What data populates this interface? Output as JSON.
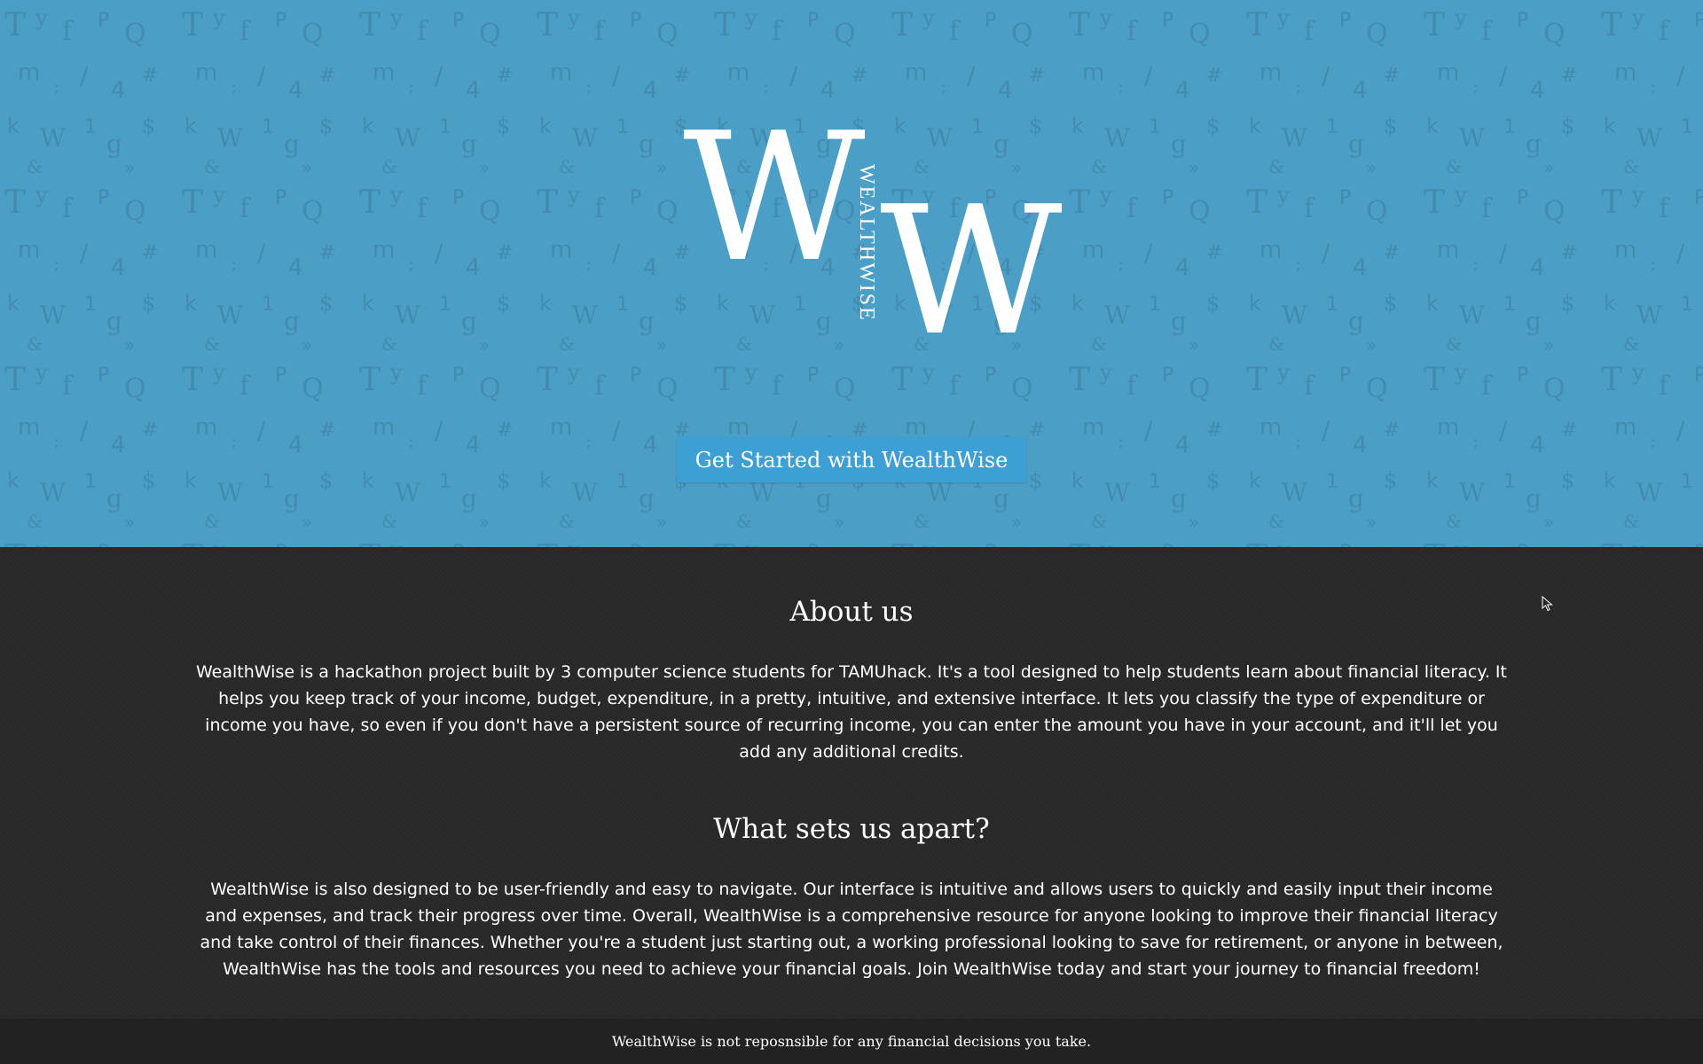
{
  "hero": {
    "logo": {
      "letter_left": "W",
      "letter_right": "W",
      "wordmark": "WEALTHWISE"
    },
    "cta_label": "Get Started with WealthWise",
    "background_color": "#4b9fc7",
    "button_color": "#3d9fd4"
  },
  "about": {
    "title": "About us",
    "text": "WealthWise is a hackathon project built by 3 computer science students for TAMUhack. It's a tool designed to help students learn about financial literacy. It helps you keep track of your income, budget, expenditure, in a pretty, intuitive, and extensive interface. It lets you classify the type of expenditure or income you have, so even if you don't have a persistent source of recurring income, you can enter the amount you have in your account, and it'll let you add any additional credits."
  },
  "apart": {
    "title": "What sets us apart?",
    "text": "WealthWise is also designed to be user-friendly and easy to navigate. Our interface is intuitive and allows users to quickly and easily input their income and expenses, and track their progress over time. Overall, WealthWise is a comprehensive resource for anyone looking to improve their financial literacy and take control of their finances. Whether you're a student just starting out, a working professional looking to save for retirement, or anyone in between, WealthWise has the tools and resources you need to achieve your financial goals. Join WealthWise today and start your journey to financial freedom!"
  },
  "footer": {
    "text": "WealthWise is not reposnsible for any financial decisions you take."
  },
  "colors": {
    "content_background": "#282828",
    "footer_background": "#222222",
    "text": "#ffffff"
  },
  "icons": {
    "cursor": "mouse-pointer-icon"
  }
}
